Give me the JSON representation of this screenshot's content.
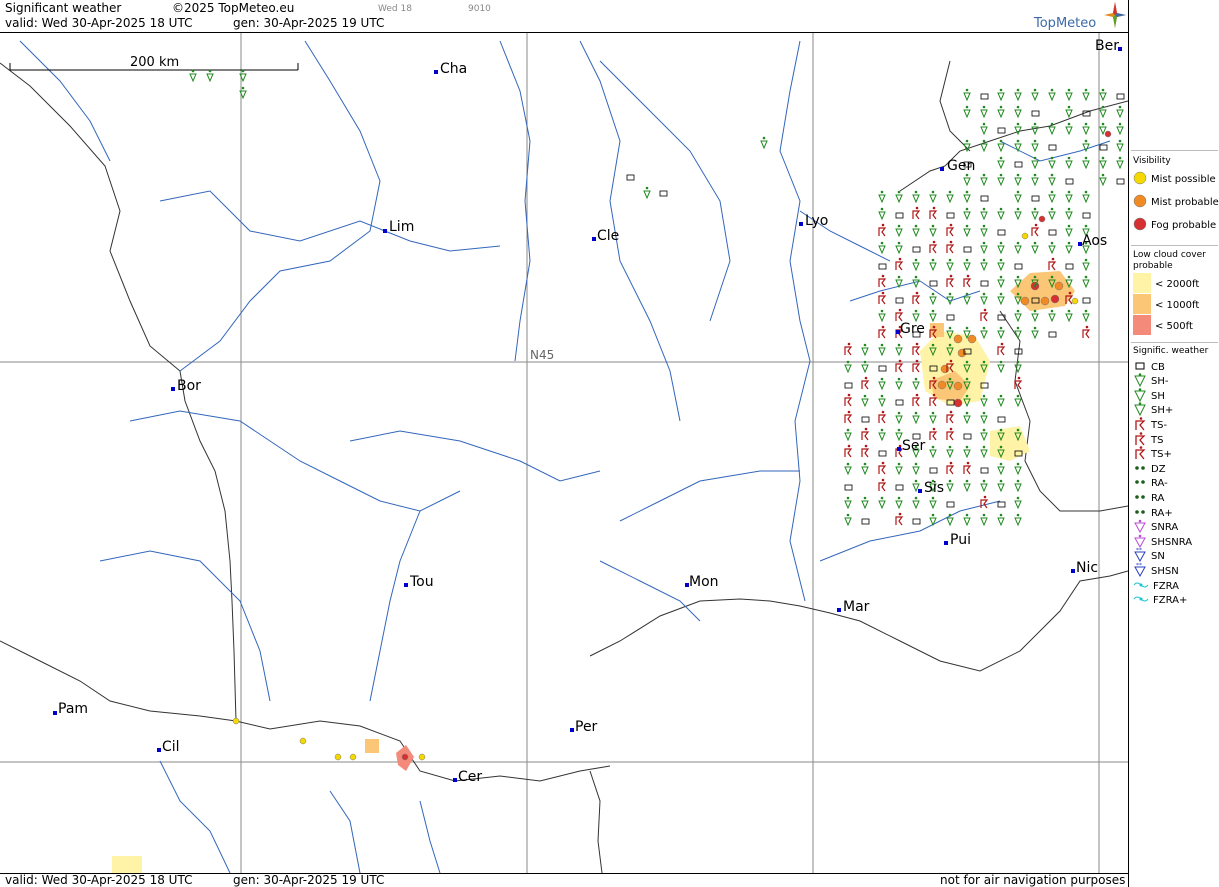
{
  "header": {
    "title": "Significant weather",
    "copyright": "©2025 TopMeteo.eu",
    "valid": "valid:  Wed  30-Apr-2025  18 UTC",
    "generated": "gen:  30-Apr-2025 19 UTC",
    "run": "Wed 18",
    "code": "9010",
    "logo": "TopMeteo"
  },
  "footer": {
    "valid": "valid:  Wed  30-Apr-2025  18 UTC",
    "generated": "gen:  30-Apr-2025 19 UTC",
    "disclaimer": "not for air navigation purposes"
  },
  "map": {
    "scale_label": "200 km",
    "grid_label": "N45",
    "cities": [
      {
        "name": "Cha"
      },
      {
        "name": "Lim"
      },
      {
        "name": "Cle"
      },
      {
        "name": "Lyo"
      },
      {
        "name": "Gen"
      },
      {
        "name": "Ber"
      },
      {
        "name": "Aos"
      },
      {
        "name": "Gre"
      },
      {
        "name": "Bor"
      },
      {
        "name": "Ser"
      },
      {
        "name": "Sis"
      },
      {
        "name": "Pui"
      },
      {
        "name": "Tou"
      },
      {
        "name": "Mon"
      },
      {
        "name": "Mar"
      },
      {
        "name": "Nic"
      },
      {
        "name": "Pam"
      },
      {
        "name": "Cil"
      },
      {
        "name": "Per"
      },
      {
        "name": "Cer"
      }
    ]
  },
  "legend": {
    "visibility_title": "Visibility",
    "visibility": [
      {
        "label": "Mist possible",
        "color": "#f5d800"
      },
      {
        "label": "Mist probable",
        "color": "#f08a24"
      },
      {
        "label": "Fog probable",
        "color": "#d63030"
      }
    ],
    "cloud_title_1": "Low cloud cover",
    "cloud_title_2": "probable",
    "cloud": [
      {
        "label": "< 2000ft",
        "color": "#fff3a8"
      },
      {
        "label": "< 1000ft",
        "color": "#fbc777"
      },
      {
        "label": "<   500ft",
        "color": "#f38a7a"
      }
    ],
    "sigwx_title": "Signific. weather",
    "sigwx": [
      {
        "label": "CB",
        "icon": "cb-icon"
      },
      {
        "label": "SH-",
        "icon": "shower-light-icon"
      },
      {
        "label": "SH",
        "icon": "shower-icon"
      },
      {
        "label": "SH+",
        "icon": "shower-heavy-icon"
      },
      {
        "label": "TS-",
        "icon": "thunderstorm-light-icon"
      },
      {
        "label": "TS",
        "icon": "thunderstorm-icon"
      },
      {
        "label": "TS+",
        "icon": "thunderstorm-heavy-icon"
      },
      {
        "label": "DZ",
        "icon": "drizzle-icon"
      },
      {
        "label": "RA-",
        "icon": "rain-light-icon"
      },
      {
        "label": "RA",
        "icon": "rain-icon"
      },
      {
        "label": "RA+",
        "icon": "rain-heavy-icon"
      },
      {
        "label": "SNRA",
        "icon": "sleet-icon"
      },
      {
        "label": "SHSNRA",
        "icon": "sleet-shower-icon"
      },
      {
        "label": "SN",
        "icon": "snow-icon"
      },
      {
        "label": "SHSN",
        "icon": "snow-shower-icon"
      },
      {
        "label": "FZRA",
        "icon": "freezing-rain-icon"
      },
      {
        "label": "FZRA+",
        "icon": "freezing-rain-heavy-icon"
      }
    ]
  }
}
